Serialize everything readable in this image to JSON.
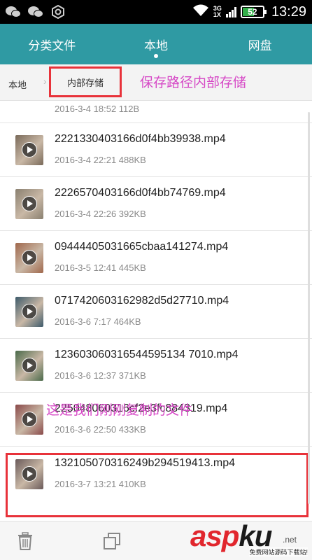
{
  "status_bar": {
    "network_top": "3G",
    "network_bottom": "1X",
    "battery": "52",
    "battery_level": 0.52,
    "time": "13:29"
  },
  "tabs": [
    {
      "label": "分类文件",
      "active": false
    },
    {
      "label": "本地",
      "active": true
    },
    {
      "label": "网盘",
      "active": false
    }
  ],
  "breadcrumb": {
    "root": "本地",
    "current": "内部存储"
  },
  "annotations": {
    "path_note": "保存路径内部存储",
    "copied_note": "这是我们刚刚复制的文件"
  },
  "partial_row_meta": "2016-3-4 18:52 112B",
  "files": [
    {
      "name": "2221330403166d0f4bb39938.mp4",
      "meta": "2016-3-4 22:21 488KB",
      "thumb_color": "#7a6a5a"
    },
    {
      "name": "2226570403166d0f4bb74769.mp4",
      "meta": "2016-3-4 22:26 392KB",
      "thumb_color": "#8a8070"
    },
    {
      "name": "09444405031665cbaa141274.mp4",
      "meta": "2016-3-5 12:41 445KB",
      "thumb_color": "#a0684c"
    },
    {
      "name": "0717420603162982d5d27710.mp4",
      "meta": "2016-3-6 7:17 464KB",
      "thumb_color": "#3d5a6a"
    },
    {
      "name": "123603060316544595134 7010.mp4",
      "meta": "2016-3-6 12:37 371KB",
      "thumb_color": "#4a6a4a"
    },
    {
      "name": "225048060316cf2e3fc884319.mp4",
      "meta": "2016-3-6 22:50 433KB",
      "thumb_color": "#8a4a4a"
    },
    {
      "name": "132105070316249b294519413.mp4",
      "meta": "2016-3-7 13:21 410KB",
      "thumb_color": "#6a5a5a"
    }
  ],
  "watermark": {
    "logo": "asp",
    "logo_accent": "ku",
    "dot": ".net",
    "sub": "免费网站源码下载站!"
  }
}
